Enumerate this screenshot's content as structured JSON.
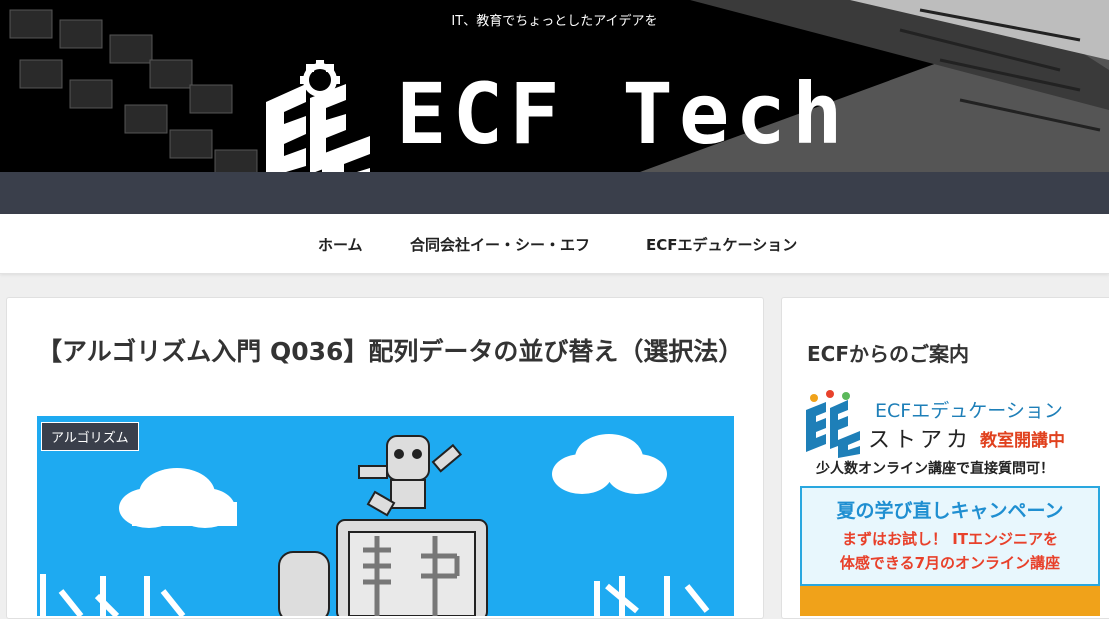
{
  "header": {
    "tagline": "IT、教育でちょっとしたアイデアを",
    "site_title": "ECF Tech"
  },
  "nav": {
    "items": [
      {
        "label": "ホーム"
      },
      {
        "label": "合同会社イー・シー・エフ"
      },
      {
        "label": "ECFエデュケーション"
      }
    ]
  },
  "article": {
    "title": "【アルゴリズム入門 Q036】配列データの並び替え（選択法）",
    "category": "アルゴリズム"
  },
  "sidebar": {
    "title": "ECFからのご案内",
    "banner": {
      "edu_name": "ECFエデュケーション",
      "stoa": "ストアカ",
      "class_open": "教室開講中",
      "small_class": "少人数オンライン講座で直接質問可！",
      "summer": "夏の学び直しキャンペーン",
      "try_it": "まずはお試し！ ITエンジニアを",
      "experience": "体感できる7月のオンライン講座"
    }
  },
  "colors": {
    "header_bg": "#000000",
    "band": "#3a3f4b",
    "eyecatch_sky": "#1eaaf1",
    "accent_blue": "#1f8fd1",
    "accent_red": "#e8412b"
  }
}
